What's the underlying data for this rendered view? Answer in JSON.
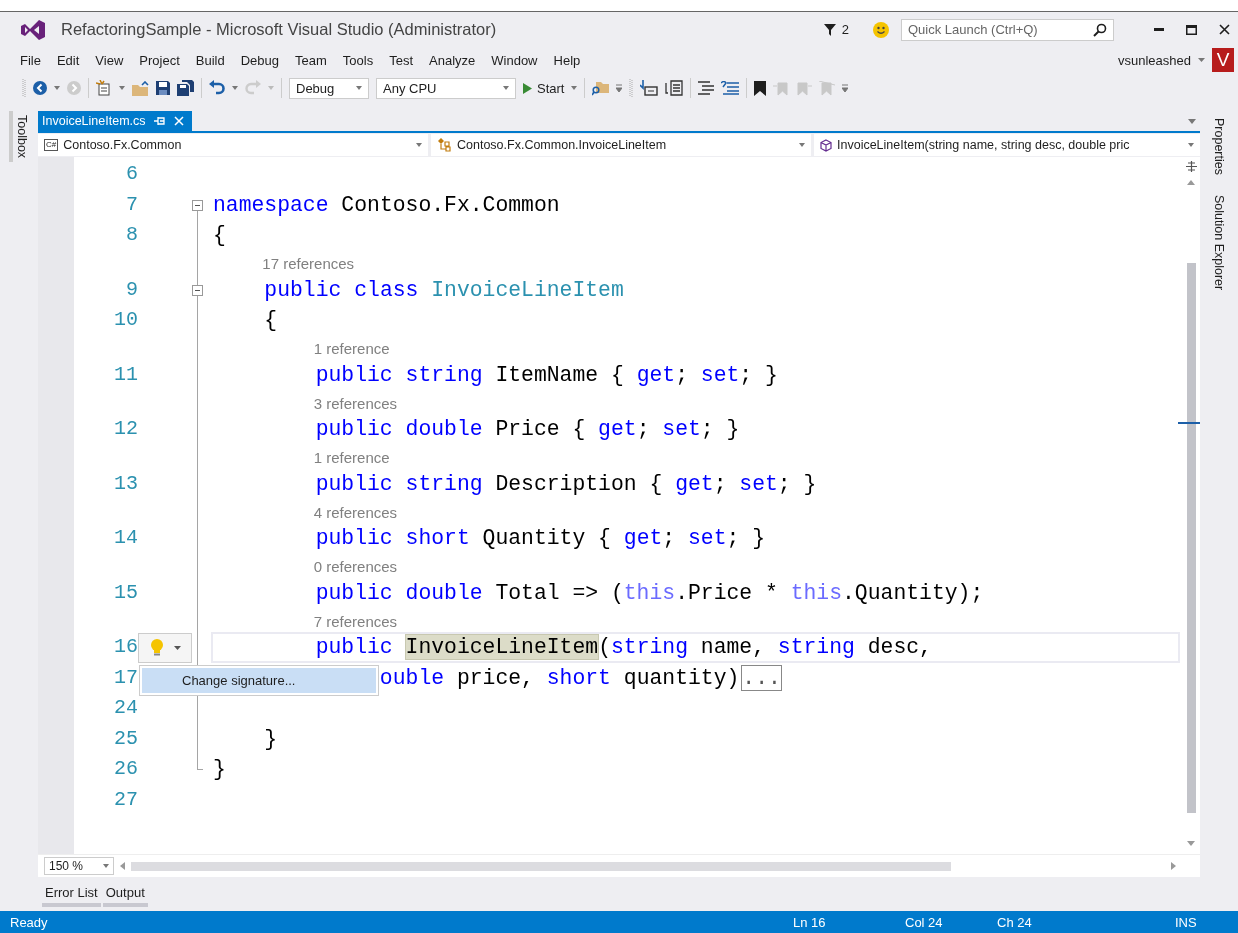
{
  "window": {
    "title": "RefactoringSample - Microsoft Visual Studio (Administrator)",
    "notification_count": "2",
    "quick_launch": {
      "placeholder": "Quick Launch (Ctrl+Q)"
    }
  },
  "menu": [
    "File",
    "Edit",
    "View",
    "Project",
    "Build",
    "Debug",
    "Team",
    "Tools",
    "Test",
    "Analyze",
    "Window",
    "Help"
  ],
  "account": {
    "user": "vsunleashed",
    "initial": "V"
  },
  "toolbar": {
    "configuration": "Debug",
    "platform": "Any CPU",
    "start": "Start"
  },
  "side_tabs_left": [
    "Toolbox"
  ],
  "side_tabs_right": [
    "Properties",
    "Solution Explorer"
  ],
  "document_tabs": [
    {
      "label": "InvoiceLineItem.cs",
      "selected": true
    }
  ],
  "nav_bar": {
    "language": "C#",
    "project": "Contoso.Fx.Common",
    "type": "Contoso.Fx.Common.InvoiceLineItem",
    "member": "InvoiceLineItem(string name, string desc, double pric"
  },
  "code_lines": [
    {
      "number": "6",
      "current": false,
      "kind": "plain"
    },
    {
      "number": "7",
      "current": false,
      "kind": "fold_start",
      "tokens": [
        {
          "text": "namespace",
          "kind": "kw"
        },
        {
          "text": " Contoso.Fx.Common",
          "kind": "plain"
        }
      ]
    },
    {
      "number": "8",
      "current": false,
      "kind": "in_fold",
      "tokens": [
        {
          "text": "{",
          "kind": "plain"
        }
      ]
    },
    {
      "number": "9",
      "current": false,
      "kind": "nested_fold_start",
      "lens": "17 references",
      "tokens": [
        {
          "text": "    public",
          "kind": "kw"
        },
        {
          "text": " class",
          "kind": "kw"
        },
        {
          "text": " InvoiceLineItem",
          "kind": "type"
        }
      ]
    },
    {
      "number": "10",
      "current": false,
      "kind": "in_fold",
      "tokens": [
        {
          "text": "    {",
          "kind": "plain"
        }
      ]
    },
    {
      "number": "11",
      "current": false,
      "kind": "in_fold",
      "lens": "1 reference",
      "tokens": [
        {
          "text": "        public",
          "kind": "kw"
        },
        {
          "text": " string",
          "kind": "kw"
        },
        {
          "text": " ItemName { ",
          "kind": "plain"
        },
        {
          "text": "get",
          "kind": "kw"
        },
        {
          "text": "; ",
          "kind": "plain"
        },
        {
          "text": "set",
          "kind": "kw"
        },
        {
          "text": "; }",
          "kind": "plain"
        }
      ]
    },
    {
      "number": "12",
      "current": false,
      "kind": "in_fold",
      "lens": "3 references",
      "tokens": [
        {
          "text": "        public",
          "kind": "kw"
        },
        {
          "text": " double",
          "kind": "kw"
        },
        {
          "text": " Price { ",
          "kind": "plain"
        },
        {
          "text": "get",
          "kind": "kw"
        },
        {
          "text": "; ",
          "kind": "plain"
        },
        {
          "text": "set",
          "kind": "kw"
        },
        {
          "text": "; }",
          "kind": "plain"
        }
      ]
    },
    {
      "number": "13",
      "current": false,
      "kind": "in_fold",
      "lens": "1 reference",
      "tokens": [
        {
          "text": "        public",
          "kind": "kw"
        },
        {
          "text": " string",
          "kind": "kw"
        },
        {
          "text": " Description { ",
          "kind": "plain"
        },
        {
          "text": "get",
          "kind": "kw"
        },
        {
          "text": "; ",
          "kind": "plain"
        },
        {
          "text": "set",
          "kind": "kw"
        },
        {
          "text": "; }",
          "kind": "plain"
        }
      ]
    },
    {
      "number": "14",
      "current": false,
      "kind": "in_fold",
      "lens": "4 references",
      "tokens": [
        {
          "text": "        public",
          "kind": "kw"
        },
        {
          "text": " short",
          "kind": "kw"
        },
        {
          "text": " Quantity { ",
          "kind": "plain"
        },
        {
          "text": "get",
          "kind": "kw"
        },
        {
          "text": "; ",
          "kind": "plain"
        },
        {
          "text": "set",
          "kind": "kw"
        },
        {
          "text": "; }",
          "kind": "plain"
        }
      ]
    },
    {
      "number": "15",
      "current": false,
      "kind": "in_fold",
      "lens": "0 references",
      "tokens": [
        {
          "text": "        public",
          "kind": "kw"
        },
        {
          "text": " double",
          "kind": "kw"
        },
        {
          "text": " Total => (",
          "kind": "plain"
        },
        {
          "text": "this",
          "kind": "this"
        },
        {
          "text": ".Price * ",
          "kind": "plain"
        },
        {
          "text": "this",
          "kind": "this"
        },
        {
          "text": ".Quantity);",
          "kind": "plain"
        }
      ]
    },
    {
      "number": "16",
      "current": true,
      "kind": "in_fold",
      "lens": "7 references",
      "lightbulb": true,
      "tokens": [
        {
          "text": "        public ",
          "kind": "kw"
        },
        {
          "text": "InvoiceLineItem",
          "kind": "ref"
        },
        {
          "text": "(",
          "kind": "plain"
        },
        {
          "text": "string",
          "kind": "kw"
        },
        {
          "text": " name, ",
          "kind": "plain"
        },
        {
          "text": "string",
          "kind": "kw"
        },
        {
          "text": " desc,",
          "kind": "plain"
        }
      ]
    },
    {
      "number": "17",
      "current": false,
      "kind": "in_fold",
      "tokens": [
        {
          "text": "             ouble",
          "kind": "kw"
        },
        {
          "text": " price, ",
          "kind": "plain"
        },
        {
          "text": "short",
          "kind": "kw"
        },
        {
          "text": " quantity)",
          "kind": "plain"
        },
        {
          "text": "...",
          "kind": "collapsed"
        }
      ]
    },
    {
      "number": "24",
      "current": false,
      "kind": "in_fold"
    },
    {
      "number": "25",
      "current": false,
      "kind": "in_fold",
      "tokens": [
        {
          "text": "    }",
          "kind": "plain"
        }
      ]
    },
    {
      "number": "26",
      "current": false,
      "kind": "fold_end",
      "tokens": [
        {
          "text": "}",
          "kind": "plain"
        }
      ]
    },
    {
      "number": "27",
      "current": false,
      "kind": "plain"
    }
  ],
  "quick_actions": {
    "items": [
      {
        "label": "Change signature...",
        "selected": true
      }
    ]
  },
  "zoom": "150 %",
  "bottom_tabs": [
    "Error List",
    "Output"
  ],
  "status_bar": {
    "message": "Ready",
    "line": "Ln 16",
    "col": "Col 24",
    "ch": "Ch 24",
    "mode": "INS"
  }
}
